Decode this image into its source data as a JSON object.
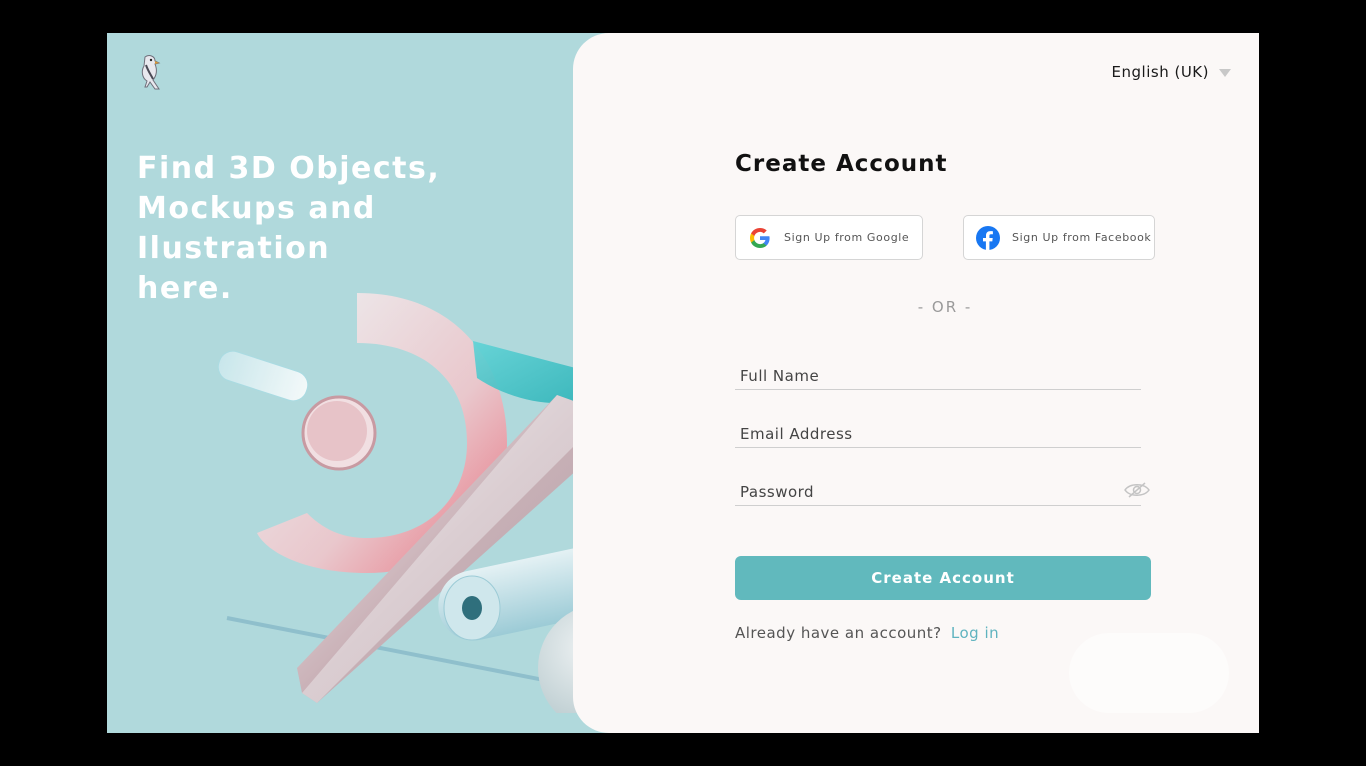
{
  "hero": {
    "line1": "Find 3D Objects,",
    "line2": "Mockups and Ilustration",
    "line3": "here."
  },
  "language": {
    "selected": "English (UK)"
  },
  "form": {
    "title": "Create Account",
    "google_label": "Sign Up from Google",
    "facebook_label": "Sign Up from Facebook",
    "divider": "- OR -",
    "full_name_placeholder": "Full Name",
    "email_placeholder": "Email Address",
    "password_placeholder": "Password",
    "submit_label": "Create Account",
    "login_prompt": "Already have an account?",
    "login_link": "Log in"
  },
  "colors": {
    "left_panel": "#b0d9dc",
    "accent": "#61b9bd",
    "link": "#5fb3bf",
    "panel_bg": "#fbf8f7"
  },
  "icons": {
    "logo": "bird-logo-icon",
    "google": "google-icon",
    "facebook": "facebook-icon",
    "password_toggle": "eye-slash-icon",
    "language_dropdown": "chevron-down-icon"
  }
}
